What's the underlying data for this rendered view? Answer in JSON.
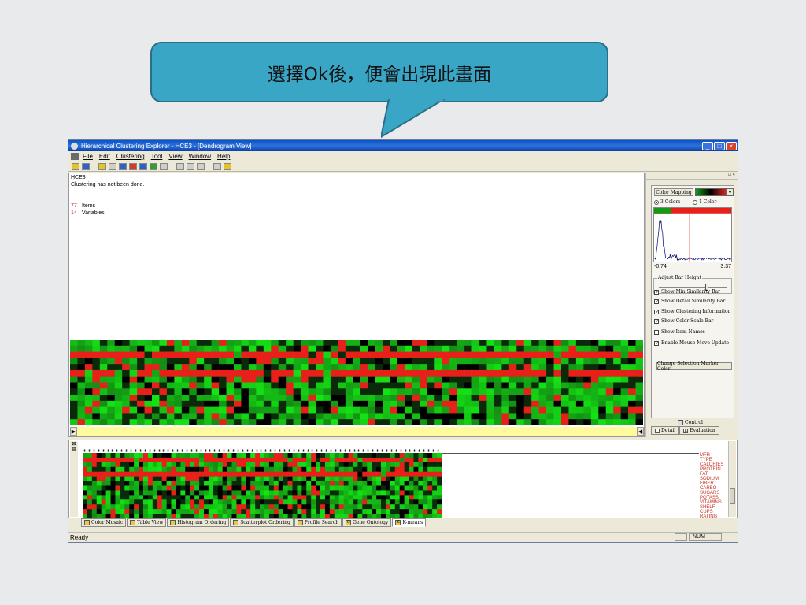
{
  "callout": {
    "text": "選擇Ok後，便會出現此畫面"
  },
  "window": {
    "title": "Hierarchical Clustering Explorer - HCE3 - [Dendrogram View]",
    "controls": [
      "_",
      "□",
      "×"
    ]
  },
  "menu": [
    "File",
    "Edit",
    "Clustering",
    "Tool",
    "View",
    "Window",
    "Help"
  ],
  "content": {
    "name": "HCE3",
    "status": "Clustering has not been done.",
    "items_count": "77",
    "items_label": "Items",
    "vars_count": "14",
    "vars_label": "Variables"
  },
  "panel": {
    "header_ctrls": "□ ×",
    "color_mapping_label": "Color Mapping",
    "radio_3": "3 Colors",
    "radio_1": "1 Color",
    "hist_min": "-0.74",
    "hist_max": "3.37",
    "adjust_label": "Adjust Bar Height",
    "adjust_level": 0.72,
    "checks": [
      {
        "label": "Show Min Similarity Bar",
        "checked": true
      },
      {
        "label": "Show Detail Similarity Bar",
        "checked": true
      },
      {
        "label": "Show Clustering Information",
        "checked": true
      },
      {
        "label": "Show Color Scale Bar",
        "checked": true
      },
      {
        "label": "Show Item Names",
        "checked": false
      },
      {
        "label": "Enable Mouse Move Update",
        "checked": true
      }
    ],
    "change_btn": "Change Selection Marker Color",
    "control_label": "Control",
    "tab_detail": "Detail",
    "tab_eval": "Evaluation",
    "tab_eval_key": "E"
  },
  "variables": [
    "MFR",
    "TYPE",
    "CALORIES",
    "PROTEIN",
    "FAT",
    "SODIUM",
    "FIBER",
    "CARBO",
    "SUGARS",
    "POTASS",
    "VITAMINS",
    "SHELF",
    "CUPS",
    "RATING"
  ],
  "bottom_tabs": [
    {
      "label": "Color Mosaic",
      "key": ""
    },
    {
      "label": "Table View",
      "key": ""
    },
    {
      "label": "Histogram Ordering",
      "key": ""
    },
    {
      "label": "Scatterplot Ordering",
      "key": ""
    },
    {
      "label": "Profile Search",
      "key": ""
    },
    {
      "label": "Gene Ontology",
      "key": "G"
    },
    {
      "label": "K-means",
      "key": "K"
    }
  ],
  "status": {
    "ready": "Ready",
    "num": "NUM"
  },
  "colors": {
    "red": "#e8201a",
    "green": "#16c416",
    "black": "#000000",
    "callout": "#3aa6c6"
  }
}
